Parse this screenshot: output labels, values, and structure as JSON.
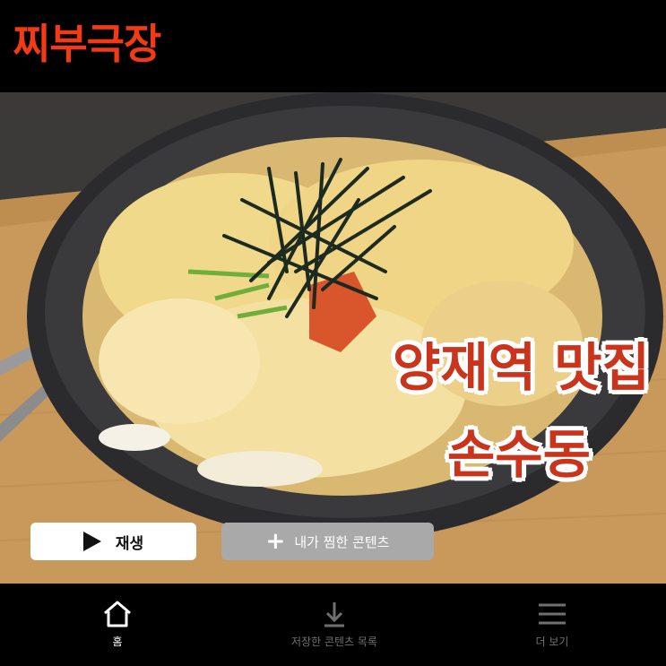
{
  "header": {
    "brand": "찌부극장",
    "brand_color": "#f23a16"
  },
  "hero": {
    "image": "bowl-of-egg-udon-with-seaweed",
    "title_line1": "양재역 맛집",
    "title_line2": "손수동",
    "title_color": "#c8341c"
  },
  "actions": {
    "play_label": "재생",
    "play_icon": "play-icon",
    "mylist_label": "내가 찜한 콘텐츠",
    "mylist_icon": "plus-icon"
  },
  "bottom_nav": {
    "items": [
      {
        "label": "홈",
        "icon": "home-icon",
        "active": true
      },
      {
        "label": "저장한 콘텐츠 목록",
        "icon": "download-icon",
        "active": false
      },
      {
        "label": "더 보기",
        "icon": "menu-icon",
        "active": false
      }
    ]
  }
}
